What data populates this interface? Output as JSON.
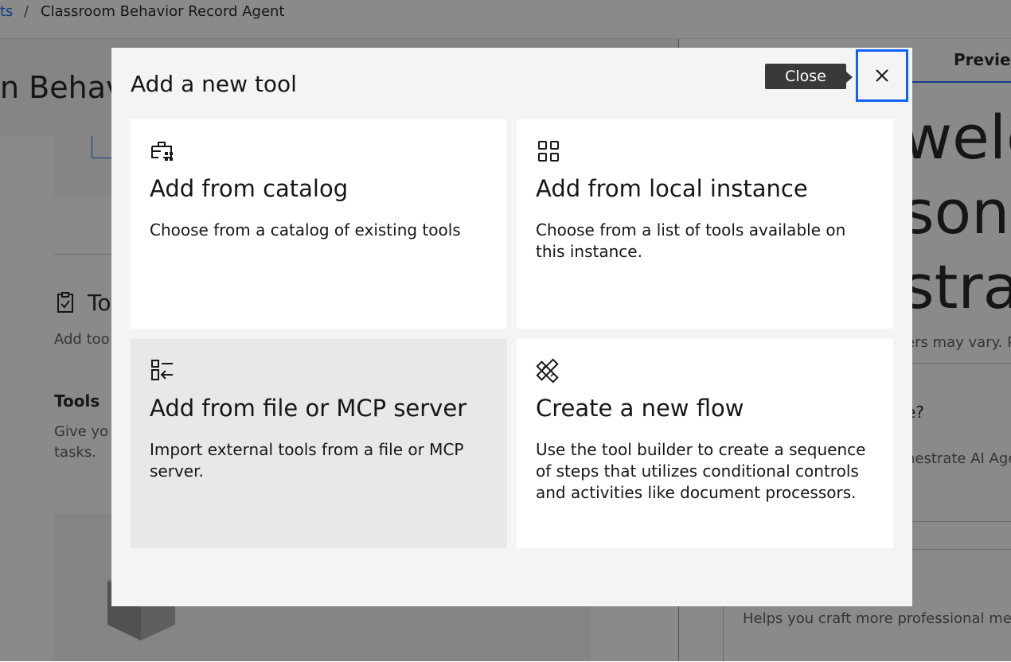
{
  "breadcrumb": {
    "parent": "ts",
    "separator": "/",
    "current": "Classroom Behavior Record Agent"
  },
  "background": {
    "hero_title": "n Behavi",
    "tools_heading": "To",
    "tools_desc": "Add too",
    "tools_subheading": "Tools",
    "tools_subdesc": "Give yo organiz tasks.",
    "preview_tab": "Previe",
    "big_lines": [
      "welc",
      "sonx",
      "strat"
    ],
    "disclaimer": "ers may vary. Pl",
    "question": "e?",
    "answer": "hestrate AI Agen",
    "helper_text": "Helps you craft more professional messa"
  },
  "modal": {
    "title": "Add a new tool",
    "close_tooltip": "Close",
    "tiles": [
      {
        "icon": "catalog-icon",
        "title": "Add from catalog",
        "description": "Choose from a catalog of existing tools"
      },
      {
        "icon": "grid-icon",
        "title": "Add from local instance",
        "description": "Choose from a list of tools available on this instance."
      },
      {
        "icon": "import-list-icon",
        "title": "Add from file or MCP server",
        "description": "Import external tools from a file or MCP server."
      },
      {
        "icon": "tools-builder-icon",
        "title": "Create a new flow",
        "description": "Use the tool builder to create a sequence of steps that utilizes conditional controls and activities like document processors."
      }
    ]
  },
  "colors": {
    "accent": "#0f62fe",
    "overlay": "#161616",
    "modal_bg": "#f4f4f4",
    "tile_hover": "#e8e8e8",
    "tooltip_bg": "#393939"
  }
}
